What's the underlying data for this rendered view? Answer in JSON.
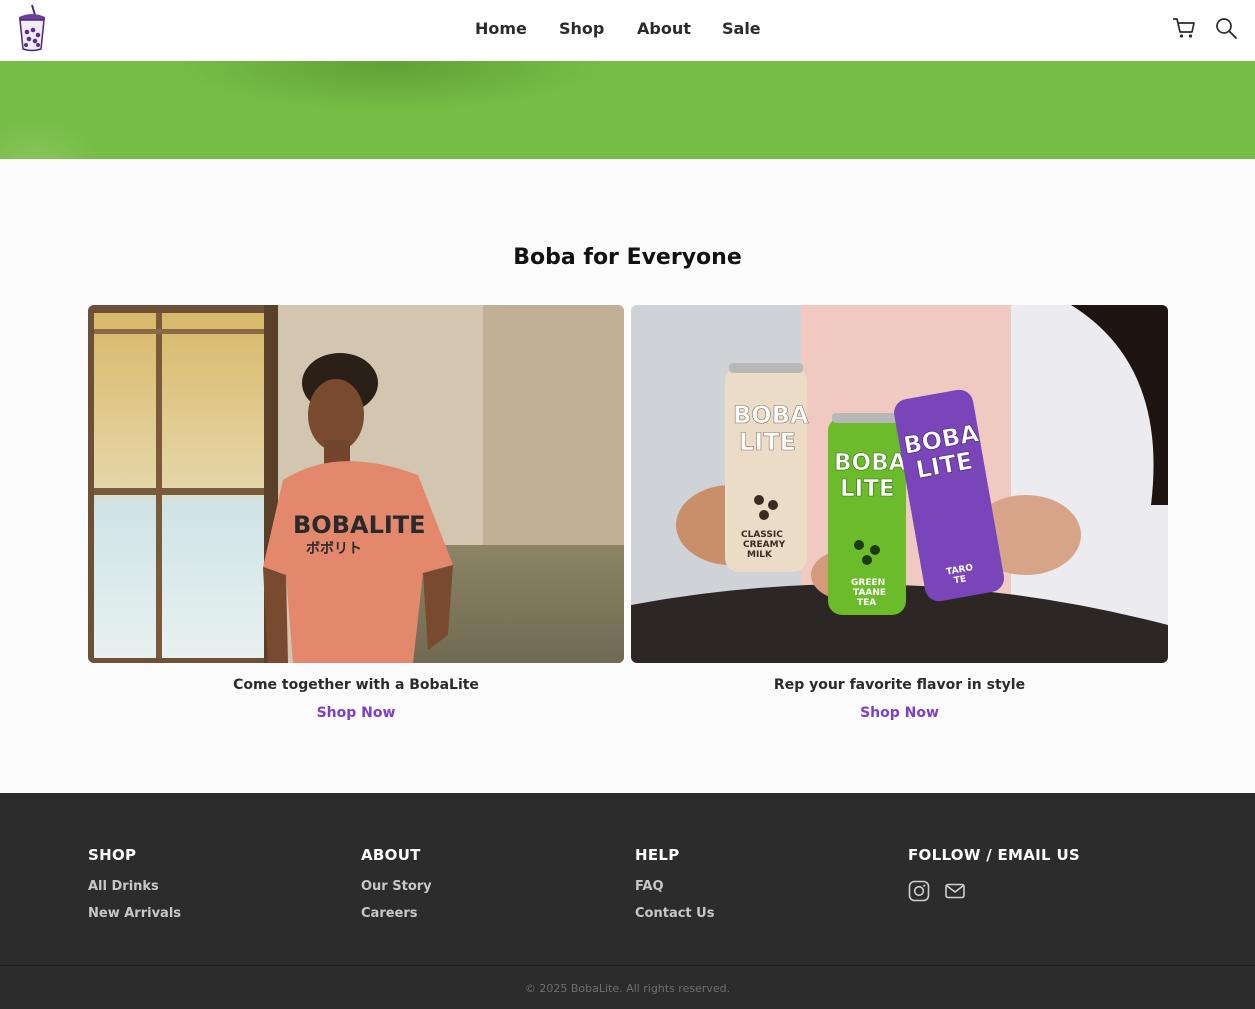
{
  "header": {
    "nav": [
      "Home",
      "Shop",
      "About",
      "Sale"
    ]
  },
  "colors": {
    "banner": "#75bd45",
    "accent": "#7b3fc9",
    "footer": "#2c2c2c"
  },
  "section": {
    "title": "Boba for Everyone",
    "cards": [
      {
        "caption": "Come together with a BobaLite",
        "link": "Shop Now",
        "image": "person-in-bobalite-tshirt"
      },
      {
        "caption": "Rep your favorite flavor in style",
        "link": "Shop Now",
        "image": "hands-holding-boba-lite-cans"
      }
    ]
  },
  "footer": {
    "columns": [
      {
        "heading": "SHOP",
        "links": [
          "All Drinks",
          "New Arrivals"
        ]
      },
      {
        "heading": "ABOUT",
        "links": [
          "Our Story",
          "Careers"
        ]
      },
      {
        "heading": "HELP",
        "links": [
          "FAQ",
          "Contact Us"
        ]
      },
      {
        "heading": "FOLLOW / EMAIL US",
        "icons": [
          "instagram-icon",
          "mail-icon"
        ]
      }
    ],
    "copyright": "© 2025 BobaLite. All rights reserved."
  },
  "image_text": {
    "shirt": [
      "BOBALITE",
      "ボボリト"
    ],
    "cans": [
      {
        "brand": [
          "BOBA",
          "LITE"
        ],
        "flavor": [
          "CLASSIC",
          "CREAMY",
          "MILK"
        ]
      },
      {
        "brand": [
          "BOBA",
          "LITE"
        ],
        "flavor": [
          "GREEN",
          "TAANE",
          "TEA"
        ]
      },
      {
        "brand": [
          "BOBA",
          "LITE"
        ],
        "flavor": [
          "TARO",
          "TE"
        ]
      }
    ]
  }
}
